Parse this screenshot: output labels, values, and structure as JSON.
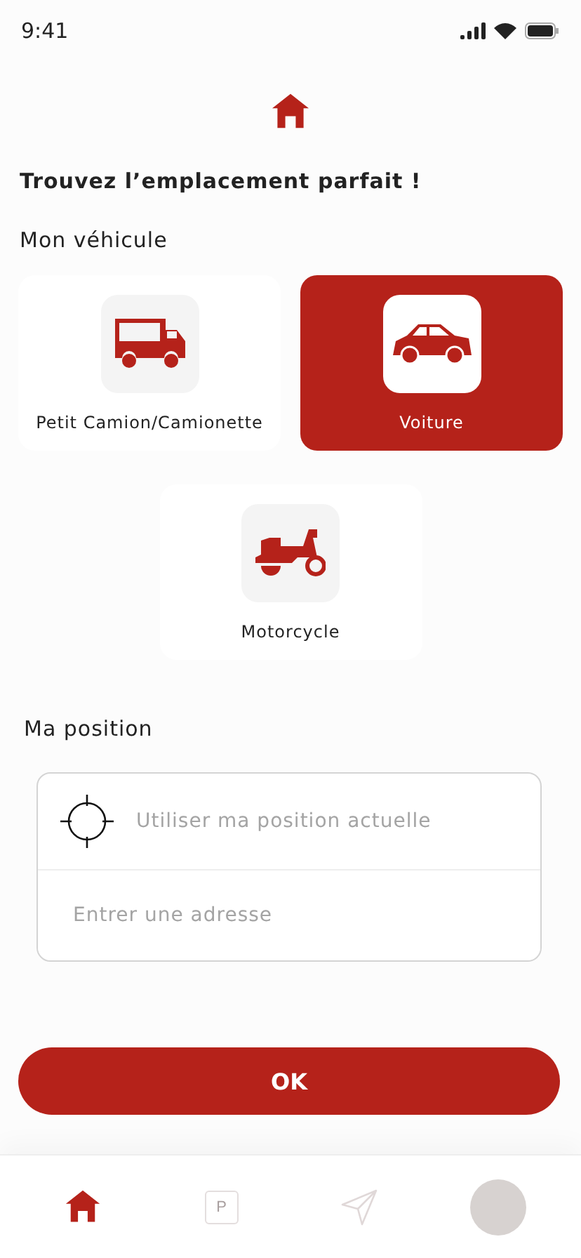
{
  "status_bar": {
    "time": "9:41"
  },
  "title": "Trouvez l’emplacement parfait !",
  "vehicle_section": {
    "label": "Mon véhicule"
  },
  "vehicles": [
    {
      "kind": "truck",
      "label": "Petit Camion/Camionette",
      "selected": false
    },
    {
      "kind": "car",
      "label": "Voiture",
      "selected": true
    },
    {
      "kind": "scooter",
      "label": "Motorcycle",
      "selected": false
    }
  ],
  "position_section": {
    "label": "Ma position",
    "current_location": {
      "placeholder": "Utiliser ma position actuelle"
    },
    "address": {
      "placeholder": "Entrer une adresse"
    }
  },
  "ok_button": "OK",
  "nav": [
    {
      "kind": "home",
      "selected": true
    },
    {
      "kind": "parking",
      "label": "P",
      "selected": false
    },
    {
      "kind": "send",
      "selected": false
    },
    {
      "kind": "avatar",
      "selected": false
    }
  ]
}
